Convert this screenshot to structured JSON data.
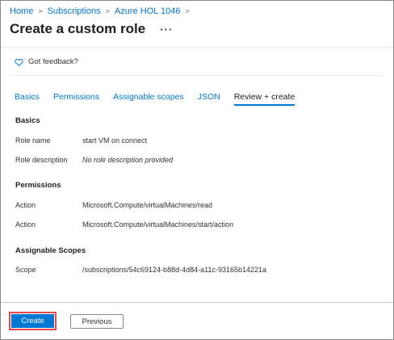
{
  "breadcrumb": {
    "items": [
      "Home",
      "Subscriptions",
      "Azure HOL 1046"
    ],
    "separator": ">"
  },
  "header": {
    "title": "Create a custom role",
    "more_label": "···"
  },
  "feedback": {
    "label": "Got feedback?",
    "icon": "heart-icon"
  },
  "tabs": [
    {
      "label": "Basics",
      "active": false
    },
    {
      "label": "Permissions",
      "active": false
    },
    {
      "label": "Assignable scopes",
      "active": false
    },
    {
      "label": "JSON",
      "active": false
    },
    {
      "label": "Review + create",
      "active": true
    }
  ],
  "basics": {
    "title": "Basics",
    "role_name_label": "Role name",
    "role_name_value": "start VM on connect",
    "role_description_label": "Role description",
    "role_description_value": "No role description provided"
  },
  "permissions": {
    "title": "Permissions",
    "rows": [
      {
        "label": "Action",
        "value": "Microsoft.Compute/virtualMachines/read"
      },
      {
        "label": "Action",
        "value": "Microsoft.Compute/virtualMachines/start/action"
      }
    ]
  },
  "scopes": {
    "title": "Assignable Scopes",
    "label": "Scope",
    "value": "/subscriptions/54c69124-b88d-4d84-a11c-93165b14221a"
  },
  "footer": {
    "create_label": "Create",
    "previous_label": "Previous"
  },
  "colors": {
    "accent": "#0078d4",
    "highlight_border": "#e8484b"
  }
}
